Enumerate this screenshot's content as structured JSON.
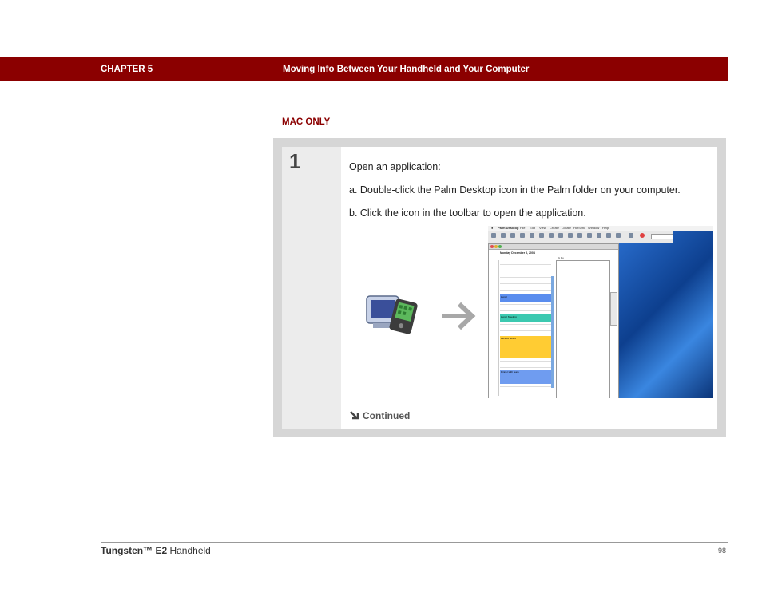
{
  "header": {
    "chapter": "CHAPTER 5",
    "title": "Moving Info Between Your Handheld and Your Computer"
  },
  "section_label": "MAC ONLY",
  "step": {
    "number": "1",
    "intro": "Open an application:",
    "item_a": "a.  Double-click the Palm Desktop icon in the Palm folder on your computer.",
    "item_b": "b.  Click the icon in the toolbar to open the application.",
    "continued": "Continued"
  },
  "screenshot": {
    "menu_items": [
      "Palm Desktop",
      "File",
      "Edit",
      "View",
      "Create",
      "Locate",
      "HotSync",
      "Window",
      "Help"
    ],
    "date_heading": "Monday December 6, 2004",
    "todo_heading": "To Do",
    "events": [
      {
        "label": "Lunch",
        "color": "#5a8dee"
      },
      {
        "label": "Lunch Meeting",
        "color": "#3cc9b0"
      },
      {
        "label": "Lecture series",
        "color": "#ffcc33"
      },
      {
        "label": "Dinner with team",
        "color": "#6f9cf0"
      }
    ]
  },
  "footer": {
    "product_brand": "Tungsten™ E2",
    "product_suffix": " Handheld",
    "page_number": "98"
  },
  "colors": {
    "header_bg": "#8b0000",
    "accent_text": "#8b0000",
    "step_frame": "#d6d6d6"
  },
  "icons": {
    "app_icon": "palm-desktop-icon",
    "arrow": "right-arrow-icon",
    "continued": "down-right-arrow-icon"
  }
}
